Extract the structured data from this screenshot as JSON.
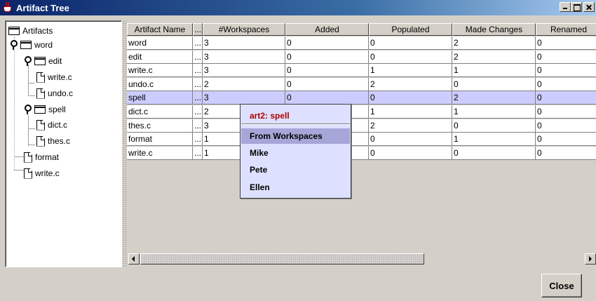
{
  "window": {
    "title": "Artifact Tree"
  },
  "tree": {
    "root": "Artifacts",
    "nodes": [
      {
        "label": "word",
        "kind": "folder"
      },
      {
        "label": "edit",
        "kind": "folder"
      },
      {
        "label": "write.c",
        "kind": "file"
      },
      {
        "label": "undo.c",
        "kind": "file"
      },
      {
        "label": "spell",
        "kind": "folder"
      },
      {
        "label": "dict.c",
        "kind": "file"
      },
      {
        "label": "thes.c",
        "kind": "file"
      },
      {
        "label": "format",
        "kind": "file"
      },
      {
        "label": "write.c",
        "kind": "file"
      }
    ]
  },
  "table": {
    "columns": [
      "Artifact Name",
      "...",
      "#Workspaces",
      "Added",
      "Populated",
      "Made Changes",
      "Renamed"
    ],
    "rows": [
      [
        "word",
        "...",
        "3",
        "0",
        "0",
        "2",
        "0"
      ],
      [
        "edit",
        "...",
        "3",
        "0",
        "0",
        "2",
        "0"
      ],
      [
        "write.c",
        "...",
        "3",
        "0",
        "1",
        "1",
        "0"
      ],
      [
        "undo.c",
        "...",
        "2",
        "0",
        "2",
        "0",
        "0"
      ],
      [
        "spell",
        "...",
        "3",
        "0",
        "0",
        "2",
        "0"
      ],
      [
        "dict.c",
        "...",
        "2",
        "",
        "1",
        "1",
        "0"
      ],
      [
        "thes.c",
        "...",
        "3",
        "",
        "2",
        "0",
        "0"
      ],
      [
        "format",
        "...",
        "1",
        "",
        "0",
        "1",
        "0"
      ],
      [
        "write.c",
        "...",
        "1",
        "",
        "0",
        "0",
        "0"
      ]
    ],
    "selected_row": 4
  },
  "popup": {
    "title": "art2: spell",
    "items": [
      "From Workspaces",
      "Mike",
      "Pete",
      "Ellen"
    ],
    "highlighted": 0
  },
  "buttons": {
    "close": "Close"
  },
  "colors": {
    "title_bar": "#0a246a",
    "selected_row": "#ccccff",
    "popup_bg": "#dde0ff",
    "popup_title": "#b00000"
  }
}
